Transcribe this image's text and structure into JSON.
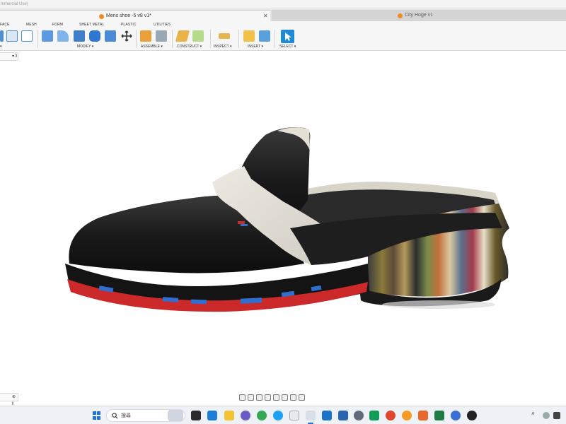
{
  "window": {
    "title_fragment": "mmercial Use)"
  },
  "tabs": [
    {
      "label": "Mens shoe -5 v8 v1*"
    },
    {
      "label": "City Hoge v1"
    }
  ],
  "workspace_tabs": [
    "FACE",
    "MESH",
    "FORM",
    "SHEET METAL",
    "PLASTIC",
    "UTILITIES"
  ],
  "tool_groups": [
    {
      "label": "▾"
    },
    {
      "label": "MODIFY ▾"
    },
    {
      "label": "ASSEMBLE ▾"
    },
    {
      "label": "CONSTRUCT ▾"
    },
    {
      "label": "INSPECT ▾"
    },
    {
      "label": "INSERT ▾"
    },
    {
      "label": "SELECT ▾"
    }
  ],
  "browser_stub": {
    "label": "▾ ‖"
  },
  "timeline_stub": {
    "label": "⊕ ‖"
  },
  "taskbar": {
    "search_placeholder": "搜尋",
    "accent": "#1e73d8"
  },
  "colors": {
    "fusion_select_blue": "#1f8ad6",
    "shoe_upper": "#1c1c1c",
    "strap": "#e7e4dc",
    "sole_red": "#cc2a2a",
    "sole_blue": "#2f6fd0"
  }
}
